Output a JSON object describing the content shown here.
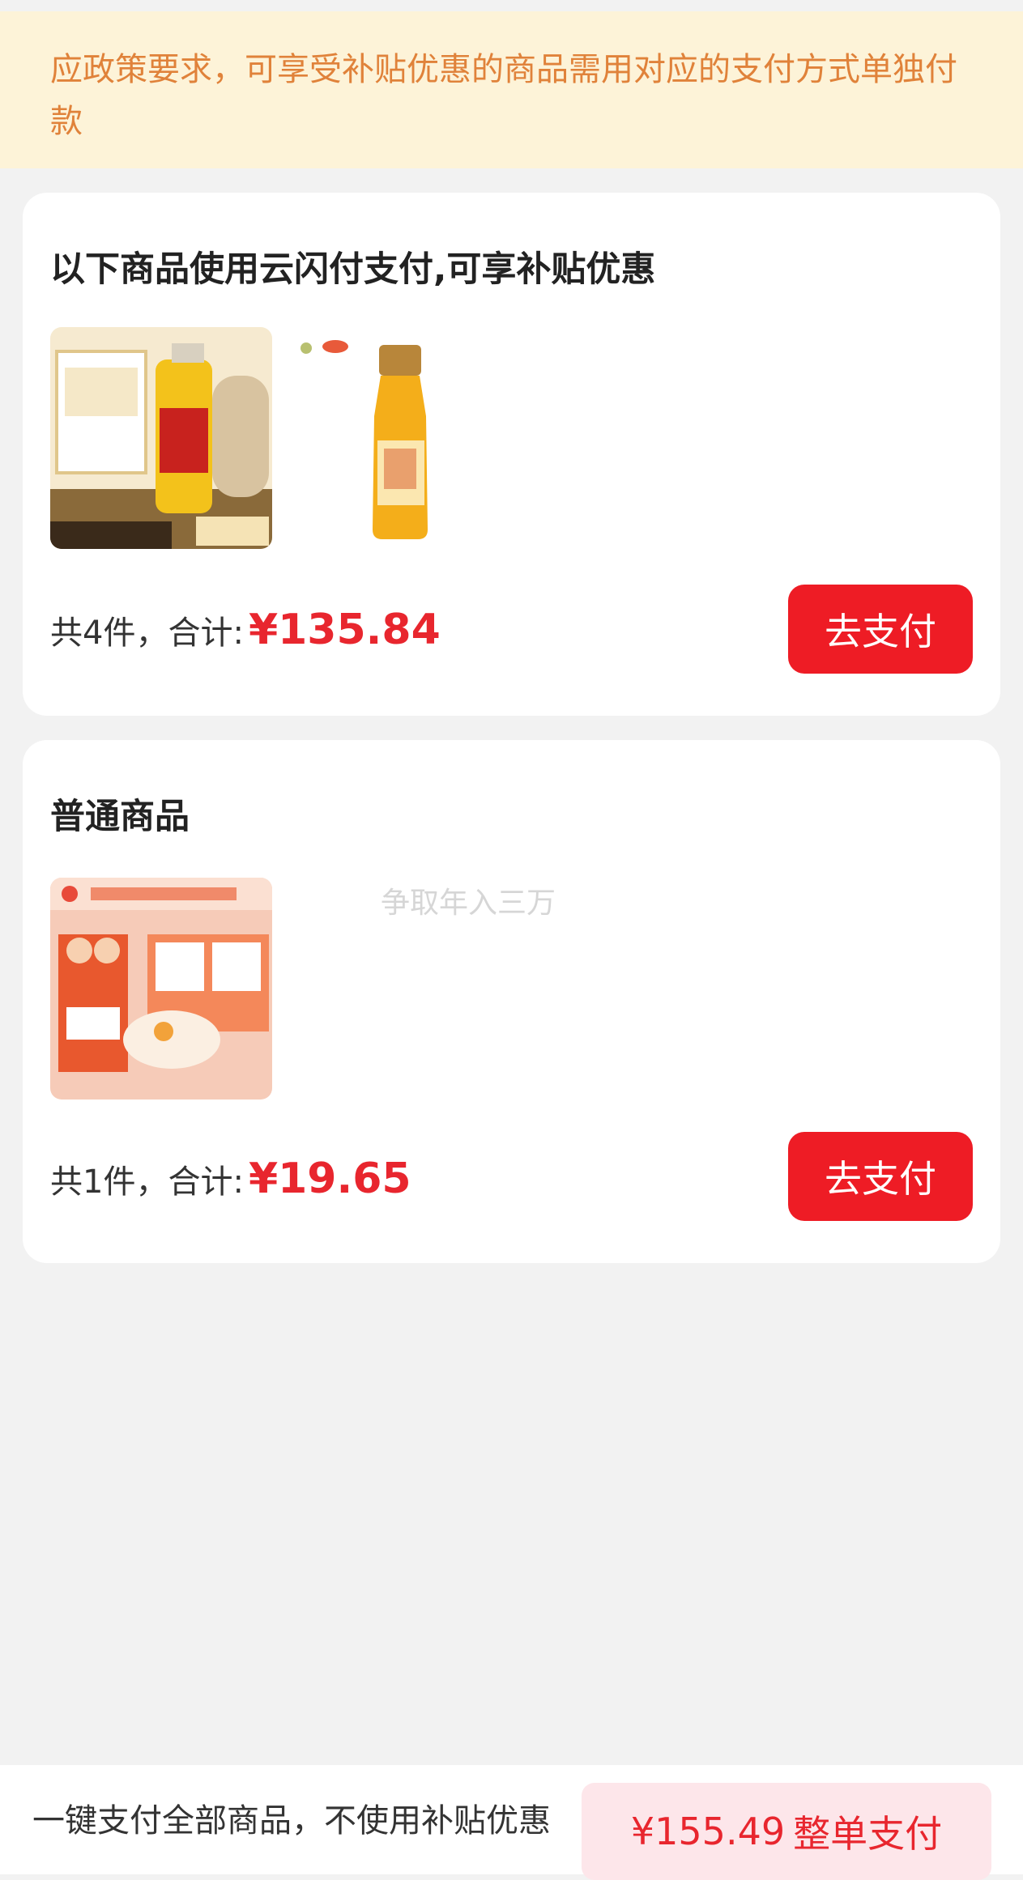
{
  "notice": {
    "text": "应政策要求，可享受补贴优惠的商品需用对应的支付方式单独付款"
  },
  "subsidy_group": {
    "title": "以下商品使用云闪付支付,可享补贴优惠",
    "products": [
      {
        "name": "oil-product-image"
      },
      {
        "name": "juice-bottle-image"
      }
    ],
    "summary_label": "共4件，合计:",
    "price": "¥135.84",
    "pay_label": "去支付"
  },
  "normal_group": {
    "title": "普通商品",
    "products": [
      {
        "name": "snack-box-image"
      }
    ],
    "summary_label": "共1件，合计:",
    "price": "¥19.65",
    "pay_label": "去支付"
  },
  "watermark": "争取年入三万",
  "bottom_bar": {
    "description": "一键支付全部商品，不使用补贴优惠",
    "total": "¥155.49",
    "pay_label": "整单支付"
  }
}
